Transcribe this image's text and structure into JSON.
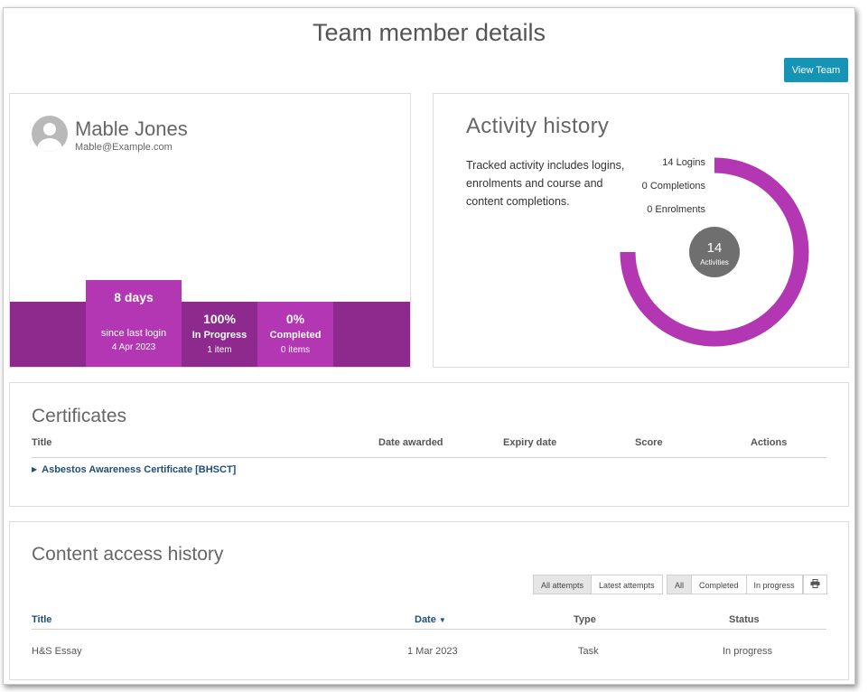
{
  "page": {
    "title": "Team member details"
  },
  "header": {
    "view_team_label": "View Team"
  },
  "profile": {
    "name": "Mable Jones",
    "email": "Mable@Example.com",
    "stats": {
      "last_login": {
        "value": "8 days",
        "label": "since last login",
        "date": "4 Apr 2023"
      },
      "in_progress": {
        "value": "100%",
        "label": "In Progress",
        "detail": "1 item"
      },
      "completed": {
        "value": "0%",
        "label": "Completed",
        "detail": "0 items"
      }
    }
  },
  "activity": {
    "title": "Activity history",
    "description": "Tracked activity includes logins, enrolments and course and content completions.",
    "legend": {
      "logins": "14 Logins",
      "completions": "0 Completions",
      "enrolments": "0 Enrolments"
    },
    "total_value": "14",
    "total_label": "Activities",
    "chart": {
      "logins": 14,
      "completions": 0,
      "enrolments": 0,
      "color": "#b336b3"
    }
  },
  "certificates": {
    "title": "Certificates",
    "columns": [
      "Title",
      "Date awarded",
      "Expiry date",
      "Score",
      "Actions"
    ],
    "rows": [
      {
        "title": "Asbestos Awareness Certificate [BHSCT]"
      }
    ]
  },
  "content_history": {
    "title": "Content access history",
    "attempt_filters": [
      "All attempts",
      "Latest attempts"
    ],
    "status_filters": [
      "All",
      "Completed",
      "In progress"
    ],
    "columns": [
      "Title",
      "Date",
      "Type",
      "Status"
    ],
    "rows": [
      {
        "title": "H&S Essay",
        "date": "1 Mar 2023",
        "type": "Task",
        "status": "In progress"
      }
    ]
  },
  "colors": {
    "accent": "#1694b6",
    "purple_dark": "#8e2a8e",
    "purple_light": "#b336b3",
    "link": "#1f4e79"
  }
}
